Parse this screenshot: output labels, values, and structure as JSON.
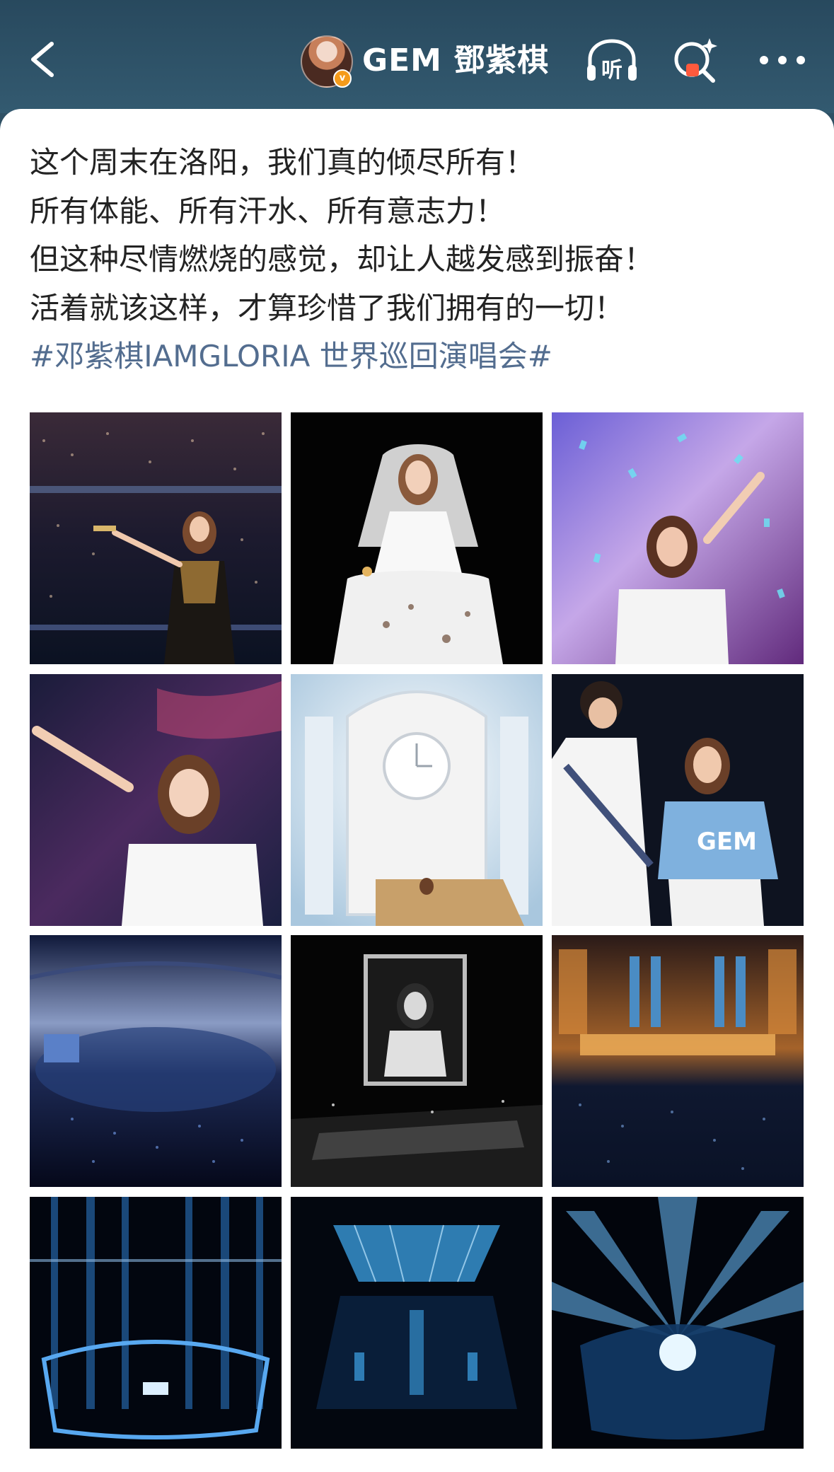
{
  "header": {
    "back_icon": "chevron-left-icon",
    "username": "GEM 鄧紫棋",
    "verified_badge": "v",
    "listen_label": "听",
    "icons": [
      "listen-icon",
      "ai-search-icon",
      "more-icon"
    ]
  },
  "post": {
    "lines": [
      "这个周末在洛阳，我们真的倾尽所有！",
      "所有体能、所有汗水、所有意志力！",
      "但这种尽情燃烧的感觉，却让人越发感到振奋！",
      "活着就该这样，才算珍惜了我们拥有的一切！"
    ],
    "hashtag": "#邓紫棋IAMGLORIA 世界巡回演唱会#"
  },
  "photos": {
    "count": 12,
    "items": [
      {
        "id": "photo-1",
        "scene": "singer-black-dress-stadium"
      },
      {
        "id": "photo-2",
        "scene": "singer-white-gown-veil"
      },
      {
        "id": "photo-3",
        "scene": "singer-confetti-arm-up"
      },
      {
        "id": "photo-4",
        "scene": "singer-white-tee-waving"
      },
      {
        "id": "photo-5",
        "scene": "white-clock-stage-set"
      },
      {
        "id": "photo-6",
        "scene": "singer-with-guitarist"
      },
      {
        "id": "photo-7",
        "scene": "stadium-wide-view"
      },
      {
        "id": "photo-8",
        "scene": "black-white-screen-stage"
      },
      {
        "id": "photo-9",
        "scene": "golden-stage-set"
      },
      {
        "id": "photo-10",
        "scene": "blue-light-beams-stage"
      },
      {
        "id": "photo-11",
        "scene": "blue-stage-overhead"
      },
      {
        "id": "photo-12",
        "scene": "blue-laser-beams-stadium"
      }
    ]
  },
  "colors": {
    "header_bg": "#2f5064",
    "hashtag": "#536d8f",
    "text": "#232323",
    "badge": "#f59b1b"
  }
}
